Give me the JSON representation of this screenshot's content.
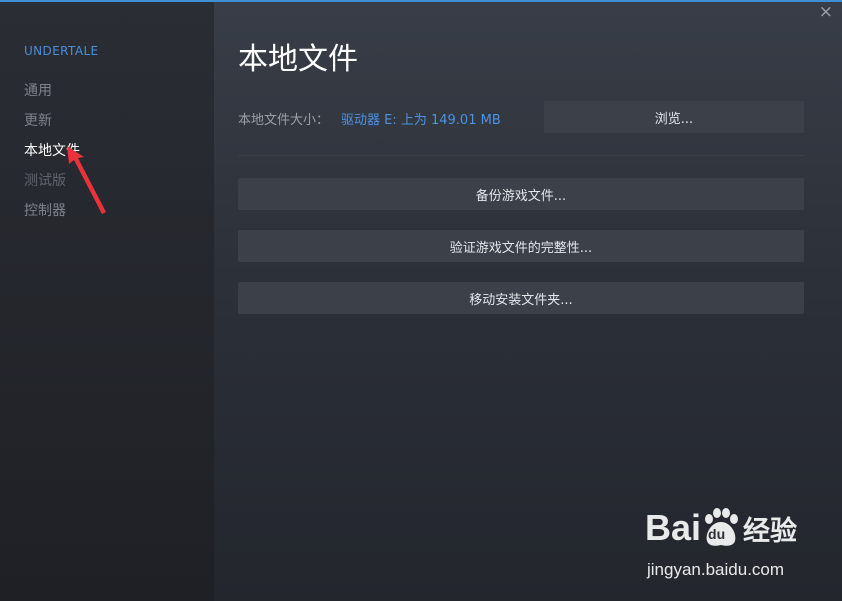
{
  "window": {
    "close_symbol": "×"
  },
  "sidebar": {
    "game_title": "UNDERTALE",
    "items": [
      {
        "label": "通用",
        "state": "normal"
      },
      {
        "label": "更新",
        "state": "normal"
      },
      {
        "label": "本地文件",
        "state": "active"
      },
      {
        "label": "测试版",
        "state": "disabled"
      },
      {
        "label": "控制器",
        "state": "normal"
      }
    ]
  },
  "main": {
    "title": "本地文件",
    "size_label": "本地文件大小：",
    "size_value": "驱动器 E: 上为 149.01 MB",
    "browse_label": "浏览...",
    "actions": [
      {
        "label": "备份游戏文件..."
      },
      {
        "label": "验证游戏文件的完整性..."
      },
      {
        "label": "移动安装文件夹..."
      }
    ]
  },
  "annotation": {
    "icon": "red-arrow-icon",
    "color": "#e8323c"
  },
  "watermark": {
    "logo_text": "Bai",
    "logo_paw": "du",
    "logo_cn": "经验",
    "url": "jingyan.baidu.com"
  },
  "colors": {
    "accent": "#4a8ed9",
    "button_bg": "#3c4049",
    "sidebar_bg": "#2a2d34"
  }
}
